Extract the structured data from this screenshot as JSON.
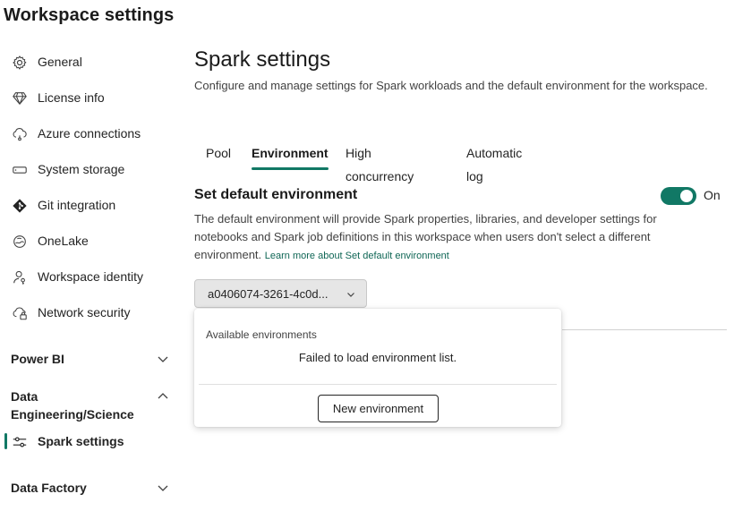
{
  "page_title": "Workspace settings",
  "sidebar": {
    "items": [
      {
        "label": "General",
        "icon": "gear-icon"
      },
      {
        "label": "License info",
        "icon": "diamond-icon"
      },
      {
        "label": "Azure connections",
        "icon": "cloud-link-icon"
      },
      {
        "label": "System storage",
        "icon": "storage-icon"
      },
      {
        "label": "Git integration",
        "icon": "git-icon"
      },
      {
        "label": "OneLake",
        "icon": "onelake-icon"
      },
      {
        "label": "Workspace identity",
        "icon": "person-key-icon"
      },
      {
        "label": "Network security",
        "icon": "cloud-lock-icon"
      }
    ],
    "sections": [
      {
        "label": "Power BI",
        "expanded": false
      },
      {
        "label": "Data Engineering/Science",
        "expanded": true,
        "items": [
          {
            "label": "Spark settings",
            "icon": "sliders-icon",
            "active": true
          }
        ]
      },
      {
        "label": "Data Factory",
        "expanded": false
      }
    ]
  },
  "main": {
    "title": "Spark settings",
    "description": "Configure and manage settings for Spark workloads and the default environment for the workspace.",
    "tabs": [
      {
        "label": "Pool",
        "active": false
      },
      {
        "label": "Environment",
        "active": true
      },
      {
        "label": "High concurrency",
        "active": false
      },
      {
        "label": "Automatic log",
        "active": false
      }
    ],
    "section": {
      "title": "Set default environment",
      "description": "The default environment will provide Spark properties, libraries, and developer settings for notebooks and Spark job definitions in this workspace when users don't select a different environment.",
      "link": "Learn more about Set default environment",
      "toggle": {
        "state": "on",
        "label": "On"
      }
    },
    "dropdown": {
      "value": "a0406074-3261-4c0d..."
    },
    "popup": {
      "heading": "Available environments",
      "error": "Failed to load environment list.",
      "button": "New environment"
    }
  },
  "colors": {
    "accent": "#117865",
    "link": "#0f6655"
  }
}
